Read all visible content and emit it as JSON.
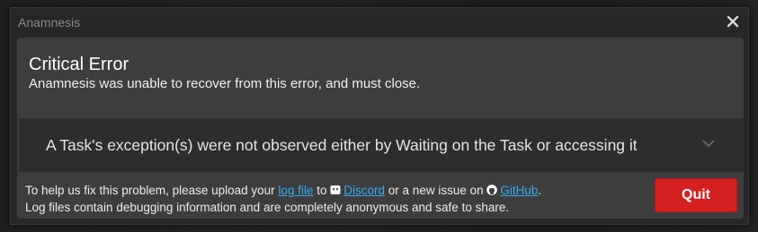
{
  "window": {
    "title": "Anamnesis"
  },
  "error": {
    "title": "Critical Error",
    "subtitle": "Anamnesis was unable to recover from this error, and must close."
  },
  "exception": {
    "message": "A Task's exception(s) were not observed either by Waiting on the Task or accessing it",
    "expand_icon": "chevron-down-icon"
  },
  "footer": {
    "line1_prefix": "To help us fix this problem, please upload your",
    "log_file_link": "log file",
    "to": "to",
    "discord_link": "Discord",
    "or_new_issue_on": "or a new issue on",
    "github_link": "GitHub",
    "period": ".",
    "line2": "Log files contain debugging information and are completely anonymous and safe to share."
  },
  "actions": {
    "quit_label": "Quit"
  },
  "colors": {
    "quit_button": "#d42020",
    "link": "#3aa8f0",
    "panel": "#3d3d3d",
    "window": "#272727"
  },
  "icons": [
    "close-icon",
    "chevron-down-icon",
    "discord-icon",
    "github-icon"
  ]
}
